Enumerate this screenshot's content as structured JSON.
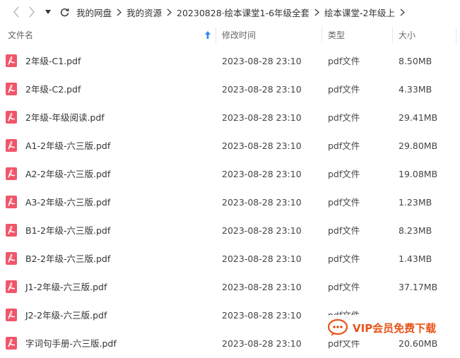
{
  "breadcrumb": [
    "我的网盘",
    "我的资源",
    "20230828·绘本课堂1-6年级全套",
    "绘本课堂-2年级上"
  ],
  "columns": {
    "name": "文件名",
    "modified": "修改时间",
    "type": "类型",
    "size": "大小"
  },
  "files": [
    {
      "name": "2年级-C1.pdf",
      "modified": "2023-08-28 23:10",
      "type": "pdf文件",
      "size": "8.50MB"
    },
    {
      "name": "2年级-C2.pdf",
      "modified": "2023-08-28 23:10",
      "type": "pdf文件",
      "size": "4.33MB"
    },
    {
      "name": "2年级-年级阅读.pdf",
      "modified": "2023-08-28 23:10",
      "type": "pdf文件",
      "size": "29.41MB"
    },
    {
      "name": "A1-2年级-六三版.pdf",
      "modified": "2023-08-28 23:10",
      "type": "pdf文件",
      "size": "29.80MB"
    },
    {
      "name": "A2-2年级-六三版.pdf",
      "modified": "2023-08-28 23:10",
      "type": "pdf文件",
      "size": "19.08MB"
    },
    {
      "name": "A3-2年级-六三版.pdf",
      "modified": "2023-08-28 23:10",
      "type": "pdf文件",
      "size": "1.23MB"
    },
    {
      "name": "B1-2年级-六三版.pdf",
      "modified": "2023-08-28 23:10",
      "type": "pdf文件",
      "size": "8.23MB"
    },
    {
      "name": "B2-2年级-六三版.pdf",
      "modified": "2023-08-28 23:10",
      "type": "pdf文件",
      "size": "1.43MB"
    },
    {
      "name": "J1-2年级-六三版.pdf",
      "modified": "2023-08-28 23:10",
      "type": "pdf文件",
      "size": "37.17MB"
    },
    {
      "name": "J2-2年级-六三版.pdf",
      "modified": "2023-08-28 23:10",
      "type": "pdf文件",
      "size": ""
    },
    {
      "name": "字词句手册-六三版.pdf",
      "modified": "2023-08-28 23:10",
      "type": "pdf文件",
      "size": "20.60MB"
    }
  ],
  "watermark": {
    "text": "VIP会员免费下载"
  },
  "colors": {
    "pdf_icon": "#f0566a",
    "watermark": "#e8541a"
  }
}
